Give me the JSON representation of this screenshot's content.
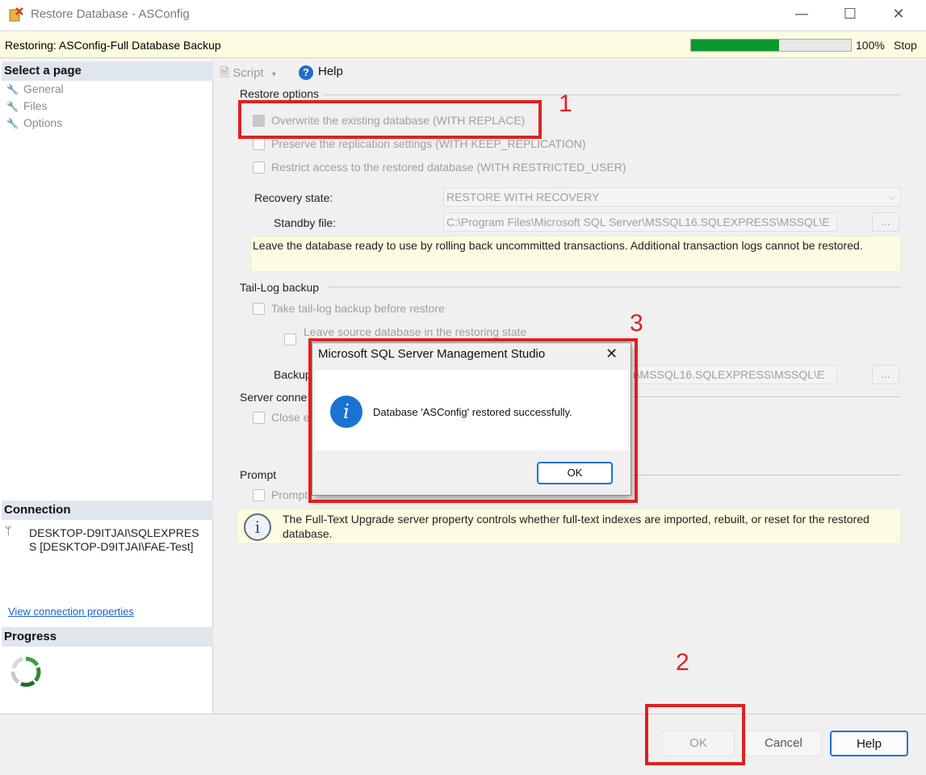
{
  "window": {
    "title": "Restore Database - ASConfig",
    "minimize_glyph": "—",
    "maximize_glyph": "☐",
    "close_glyph": "✕"
  },
  "status": {
    "text": "Restoring: ASConfig-Full Database Backup",
    "progress_fraction": 0.55,
    "percent_label": "100%",
    "stop_label": "Stop"
  },
  "left": {
    "select_page_header": "Select a page",
    "pages": [
      "General",
      "Files",
      "Options"
    ],
    "connection_header": "Connection",
    "connection_line1": "DESKTOP-D9ITJAI\\SQLEXPRES",
    "connection_line2": "S [DESKTOP-D9ITJAI\\FAE-Test]",
    "view_connection_link": "View connection properties",
    "progress_header": "Progress"
  },
  "toolbar": {
    "script_label": "Script",
    "help_label": "Help"
  },
  "restore_options": {
    "group_label": "Restore options",
    "overwrite_label": "Overwrite the existing database (WITH REPLACE)",
    "preserve_label": "Preserve the replication settings (WITH KEEP_REPLICATION)",
    "restrict_label": "Restrict access to the restored database (WITH RESTRICTED_USER)",
    "recovery_state_label": "Recovery state:",
    "recovery_state_value": "RESTORE WITH RECOVERY",
    "standby_label": "Standby file:",
    "standby_value": "C:\\Program Files\\Microsoft SQL Server\\MSSQL16.SQLEXPRESS\\MSSQL\\E",
    "browse_label": "...",
    "info_text": "Leave the database ready to use by rolling back uncommitted transactions. Additional transaction logs cannot be restored."
  },
  "tail_log": {
    "group_label": "Tail-Log backup",
    "take_label": "Take tail-log backup before restore",
    "leave_label": "Leave source database in the restoring state",
    "backup_label": "Backup",
    "backup_value": "r\\MSSQL16.SQLEXPRESS\\MSSQL\\E",
    "browse_label": "..."
  },
  "server_connections": {
    "group_label": "Server conne",
    "close_label": "Close e"
  },
  "prompt": {
    "group_label": "Prompt",
    "prompt_label": "Prompt",
    "info_text": "The Full-Text Upgrade server property controls whether full-text indexes are imported, rebuilt, or reset for the restored database."
  },
  "dialog": {
    "title": "Microsoft SQL Server Management Studio",
    "message": "Database 'ASConfig' restored successfully.",
    "ok_label": "OK",
    "info_glyph": "i",
    "close_glyph": "✕"
  },
  "annotations": {
    "n1": "1",
    "n2": "2",
    "n3": "3"
  },
  "buttons": {
    "ok": "OK",
    "cancel": "Cancel",
    "help": "Help"
  },
  "colors": {
    "annotation": "#e02020",
    "progress": "#0a9a2c",
    "accent": "#1a73d0"
  }
}
